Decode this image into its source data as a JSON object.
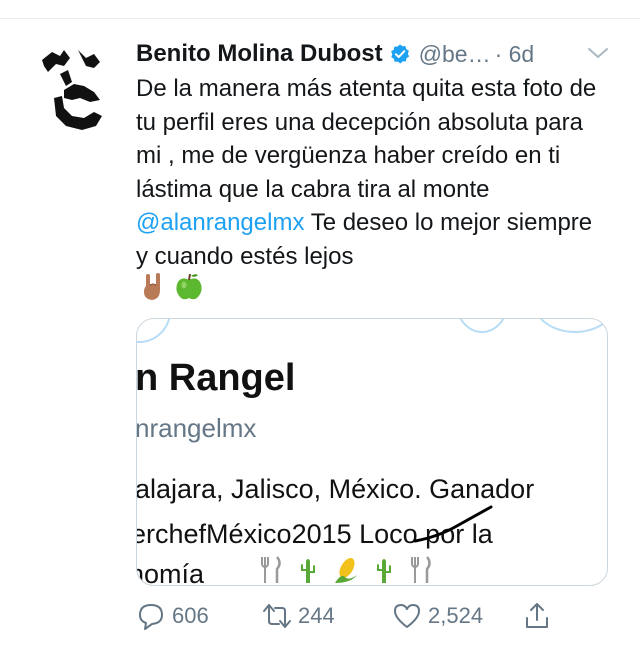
{
  "tweet": {
    "author_name": "Benito Molina Dubost",
    "handle": "@be…",
    "time": "· 6d",
    "text_before_mention": "De la manera más atenta quita esta foto de tu perfil eres una decepción absoluta para mi , me de vergüenza haber creído en ti lástima que la cabra tira al monte ",
    "mention": "@alanrangelmx",
    "text_after_mention": "  Te deseo lo mejor siempre y cuando estés lejos",
    "emojis": [
      "rock-hand-emoji",
      "green-apple-emoji"
    ]
  },
  "media": {
    "name_fragment": "n Rangel",
    "handle_fragment": "nrangelmx",
    "bio_line1": "alajara, Jalisco, México. Ganador",
    "bio_line2": "erchefMéxico2015 Loco por la",
    "bio_line3": "nomía"
  },
  "actions": {
    "reply_count": "606",
    "retweet_count": "244",
    "like_count": "2,524"
  },
  "colors": {
    "accent": "#1da1f2",
    "muted": "#657786",
    "text": "#14171a"
  }
}
